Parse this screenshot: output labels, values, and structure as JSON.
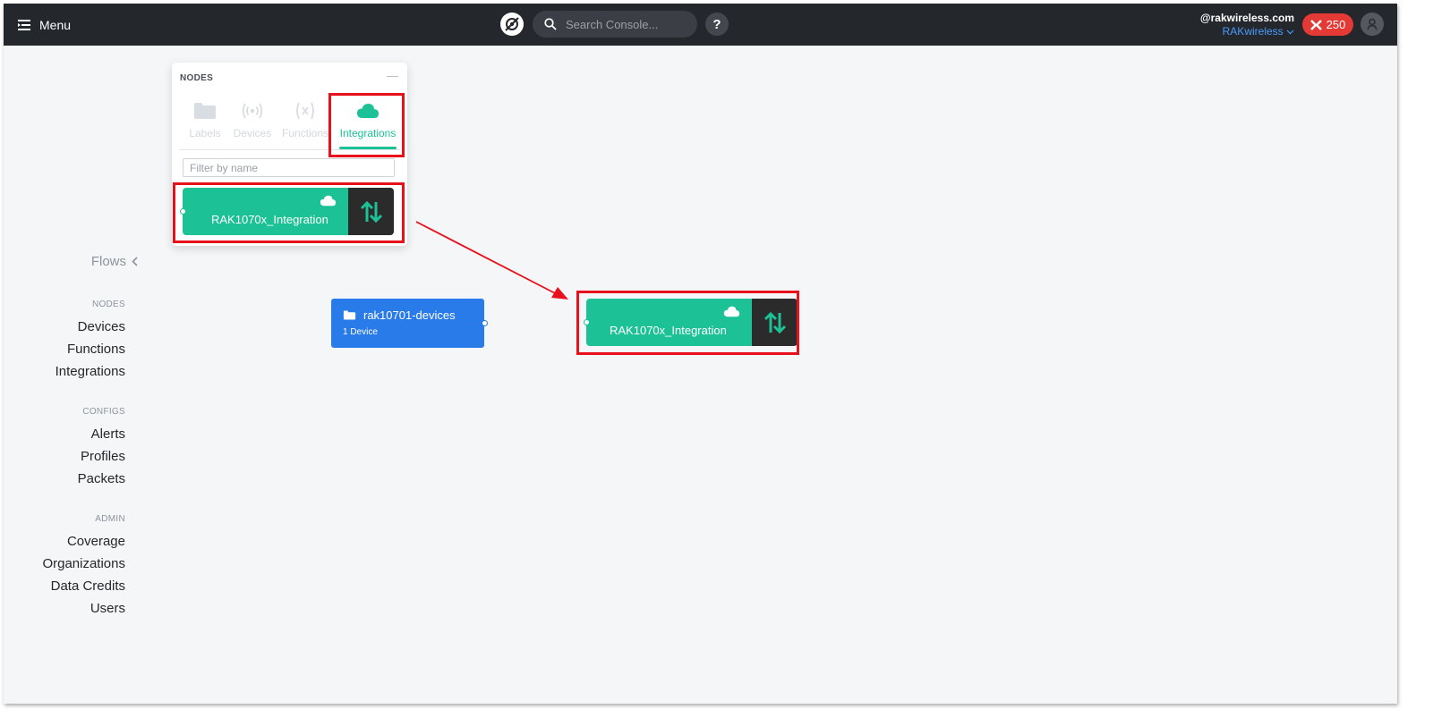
{
  "topbar": {
    "menu_label": "Menu",
    "search_placeholder": "Search Console...",
    "help_label": "?",
    "account_email": "@rakwireless.com",
    "org_name": "RAKwireless",
    "credits": "250"
  },
  "sidebar": {
    "flows_label": "Flows",
    "sections": [
      {
        "heading": "NODES",
        "items": [
          "Devices",
          "Functions",
          "Integrations"
        ]
      },
      {
        "heading": "CONFIGS",
        "items": [
          "Alerts",
          "Profiles",
          "Packets"
        ]
      },
      {
        "heading": "ADMIN",
        "items": [
          "Coverage",
          "Organizations",
          "Data Credits",
          "Users"
        ]
      }
    ]
  },
  "nodes_panel": {
    "title": "NODES",
    "minimize": "—",
    "tabs": [
      "Labels",
      "Devices",
      "Functions",
      "Integrations"
    ],
    "active_tab": "Integrations",
    "filter_placeholder": "Filter by name",
    "list_item": "RAK1070x_Integration"
  },
  "canvas": {
    "device_node": {
      "title": "rak10701-devices",
      "count": "1 Device"
    },
    "integration_node": {
      "title": "RAK1070x_Integration"
    }
  },
  "colors": {
    "topbar": "#24272b",
    "integration_green": "#1cc296",
    "device_blue": "#2a7bea",
    "highlight_red": "#e8101a",
    "credits_red": "#e53935",
    "org_link": "#4a9cff"
  }
}
